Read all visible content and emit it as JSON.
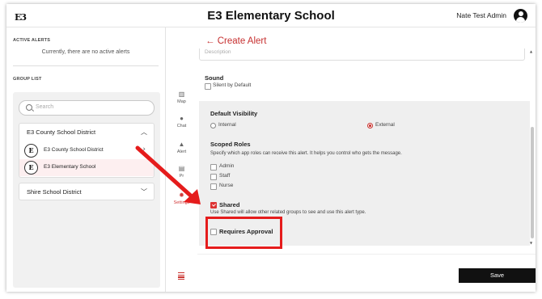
{
  "header": {
    "logo_text": "E3",
    "title": "E3 Elementary School",
    "user_name": "Nate Test Admin",
    "avatar_icon": "account-circle-icon"
  },
  "left_panel": {
    "active_alerts_heading": "ACTIVE ALERTS",
    "no_alerts_text": "Currently, there are no active alerts",
    "group_list_heading": "GROUP LIST",
    "search_placeholder": "Search",
    "districts": [
      {
        "name": "E3 County School District",
        "expanded": true,
        "schools": [
          {
            "initial": "E",
            "name": "E3 County School District",
            "selected": false
          },
          {
            "initial": "E",
            "name": "E3 Elementary School",
            "selected": true
          }
        ]
      },
      {
        "name": "Shire School District",
        "expanded": false,
        "schools": []
      }
    ]
  },
  "nav_rail": {
    "items": [
      {
        "label": "Map",
        "icon": "map-icon"
      },
      {
        "label": "Chat",
        "icon": "chat-icon"
      },
      {
        "label": "Alert",
        "icon": "warning-icon"
      },
      {
        "label": "Pr",
        "icon": "clipboard-icon"
      },
      {
        "label": "Settings",
        "icon": "gear-icon",
        "active": true
      }
    ],
    "menu_icon": "menu-icon"
  },
  "form": {
    "back_title": "← Create Alert",
    "description_placeholder": "Description",
    "sound_label": "Sound",
    "silent_label": "Silent by Default",
    "silent_checked": false,
    "visibility_label": "Default Visibility",
    "visibility_options": [
      "Internal",
      "External"
    ],
    "visibility_selected": "External",
    "scoped_roles_label": "Scoped Roles",
    "scoped_roles_help": "Specify which app roles can receive this alert. It helps you control who gets the message.",
    "roles": [
      {
        "name": "Admin",
        "checked": false
      },
      {
        "name": "Staff",
        "checked": false
      },
      {
        "name": "Nurse",
        "checked": false
      }
    ],
    "shared_label": "Shared",
    "shared_checked": true,
    "shared_help": "Use Shared will allow other related groups to see and use this alert type.",
    "requires_approval_label": "Requires Approval",
    "requires_approval_checked": false,
    "save_label": "Save"
  },
  "annotation": {
    "arrow_color": "#e51c1c",
    "box_color": "#e51c1c"
  },
  "colors": {
    "accent": "#c62f2f",
    "save_button": "#111111"
  }
}
